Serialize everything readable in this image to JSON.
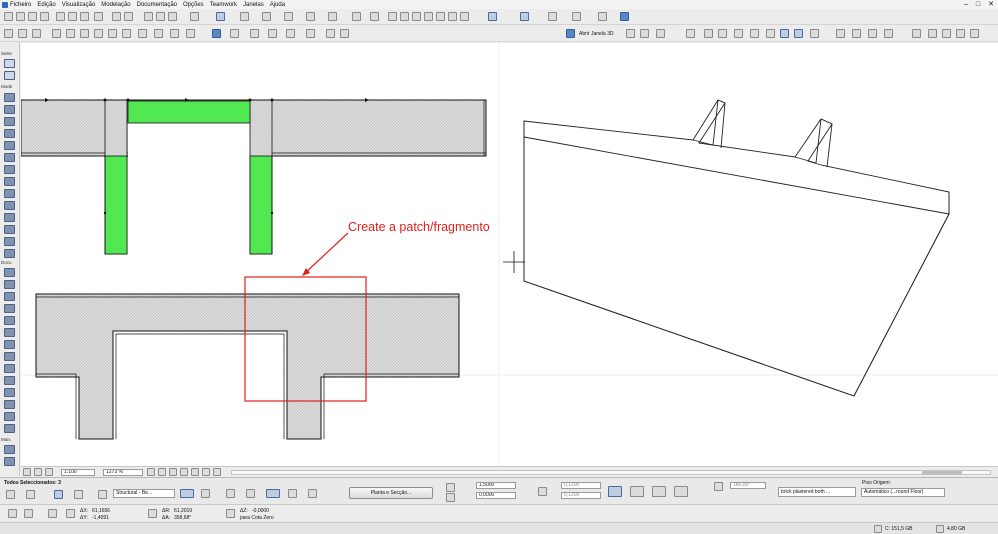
{
  "menubar": {
    "items": [
      "Ficheiro",
      "Edição",
      "Visualização",
      "Modelação",
      "Documentação",
      "Opções",
      "Teamwork",
      "Janelas",
      "Ajuda"
    ],
    "window_buttons": [
      "–",
      "□",
      "✕"
    ]
  },
  "toolbar2": {
    "open_3d_window_label": "Abrir Janela 3D"
  },
  "toolbox": {
    "group_select": "Selec",
    "group_model": "Mode",
    "group_document": "Docu",
    "group_more": "Mais"
  },
  "canvas": {
    "annotation_text": "Create a patch/fragmento",
    "annotation_color": "#e0201c",
    "wall_fill_color": "#d9d9d9",
    "green_fill_color": "#52e852"
  },
  "navbar": {
    "scale": "1:100",
    "zoom": "1273 %"
  },
  "infobox": {
    "selected_label": "Todos Seleccionados: 3",
    "structure_combo": "Structural - Be...",
    "height_top": "1,5000",
    "height_bottom": "0,0000",
    "offset_a": "0,1200",
    "offset_b": "0,1200",
    "floor_plan_button": "Planta e Secção...",
    "angle_value": "180,00°",
    "surface_combo": "brick plastered both ...",
    "plan_origin_title": "Piso Origem:",
    "plan_origin_value": "Automático (...round Floor)"
  },
  "coordbar": {
    "dx_label": "ΔX:",
    "dx_value": "61,1656",
    "dy_label": "ΔY:",
    "dy_value": "-1,4091",
    "dr_label": "ΔR:",
    "dr_value": "61,2019",
    "da_label": "ΔA:",
    "da_value": "358,68°",
    "dz_label": "ΔZ:",
    "dz_value": "-0,0000",
    "dz_ref": "para Cota Zero"
  },
  "statusbar": {
    "disk_free": "C: 151,5 GB",
    "memory": "4,80 GB"
  }
}
